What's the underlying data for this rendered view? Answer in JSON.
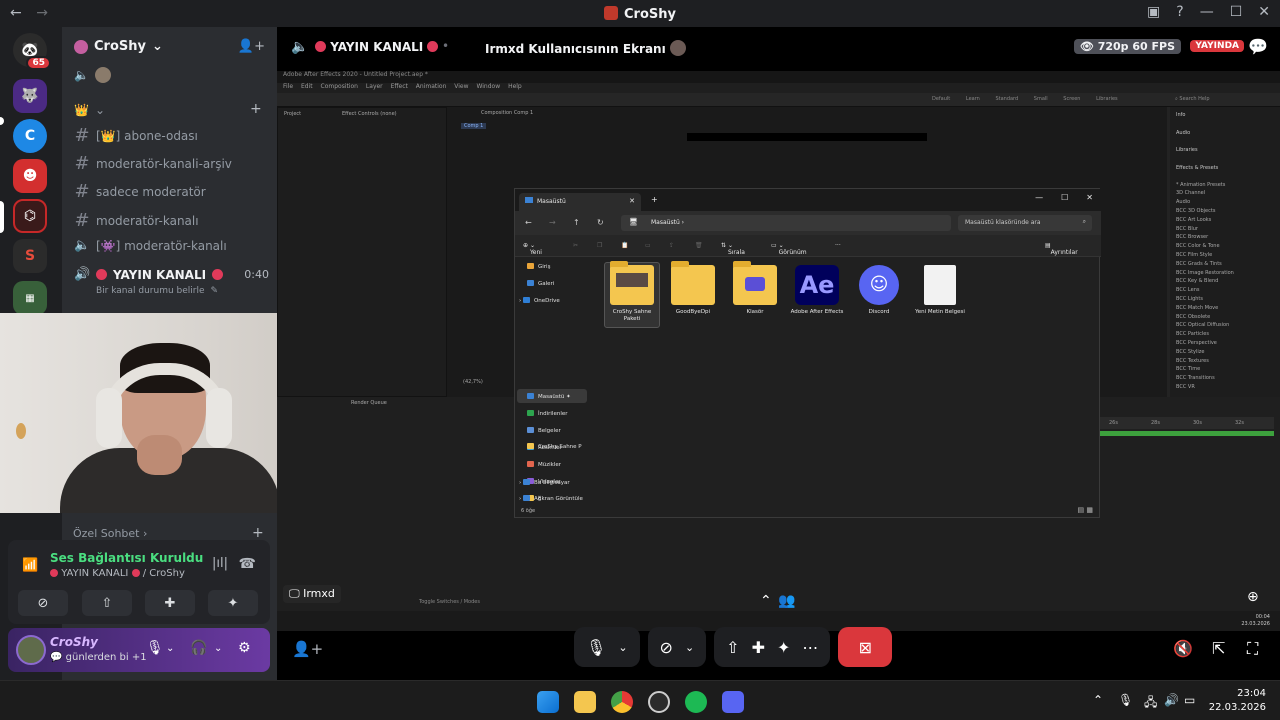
{
  "window": {
    "title": "CroShy",
    "back": "←",
    "forward": "→"
  },
  "server": {
    "name": "CroShy",
    "badge_count": "65"
  },
  "channels": [
    {
      "type": "text",
      "name": "[👑] abone-odası"
    },
    {
      "type": "text",
      "name": "moderatör-kanali-arşiv"
    },
    {
      "type": "text",
      "name": "sadece moderatör"
    },
    {
      "type": "text",
      "name": "moderatör-kanalı"
    },
    {
      "type": "voice",
      "name": "[👾] moderatör-kanalı"
    }
  ],
  "live_channel": {
    "name": "YAYIN KANALI",
    "time": "0:40",
    "status_placeholder": "Bir kanal durumu belirle"
  },
  "private_chat": {
    "label": "Özel Sohbet"
  },
  "voice_panel": {
    "status": "Ses Bağlantısı Kuruldu",
    "channel": "YAYIN KANALI",
    "server": "/ CroShy"
  },
  "user": {
    "name": "CroShy",
    "status": "günlerden bi +1"
  },
  "stream_header": {
    "channel": "YAYIN KANALI",
    "screen_title": "Irmxd Kullanıcısının Ekranı",
    "quality": "720p 60 FPS",
    "live_badge": "YAYINDA"
  },
  "viewer_label": "Irmxd",
  "after_effects": {
    "title": "Adobe After Effects 2020 - Untitled Project.aep *",
    "menu": [
      "File",
      "Edit",
      "Composition",
      "Layer",
      "Effect",
      "Animation",
      "View",
      "Window",
      "Help"
    ],
    "workspaces": [
      "Default",
      "Learn",
      "Standard",
      "Small Screen",
      "Libraries"
    ],
    "search_help": "Search Help",
    "panels": {
      "project": "Project",
      "effect_controls": "Effect Controls (none)",
      "composition": "Composition Comp 1",
      "comp_tab": "Comp 1",
      "render_queue": "Render Queue",
      "zoom": "(42,7%)",
      "toggle": "Toggle Switches / Modes"
    },
    "right_panel": {
      "headings": [
        "Info",
        "Audio",
        "Libraries",
        "Effects & Presets"
      ],
      "items": [
        "* Animation Presets",
        "3D Channel",
        "Audio",
        "BCC 3D Objects",
        "BCC Art Looks",
        "BCC Blur",
        "BCC Browser",
        "BCC Color & Tone",
        "BCC Film Style",
        "BCC Grads & Tints",
        "BCC Image Restoration",
        "BCC Key & Blend",
        "BCC Lens",
        "BCC Lights",
        "BCC Match Move",
        "BCC Obsolete",
        "BCC Optical Diffusion",
        "BCC Particles",
        "BCC Perspective",
        "BCC Stylize",
        "BCC Textures",
        "BCC Time",
        "BCC Transitions",
        "BCC VR"
      ]
    },
    "ruler": [
      "26s",
      "28s",
      "30s",
      "32s"
    ]
  },
  "explorer": {
    "tab_title": "Masaüstü",
    "path": "Masaüstü",
    "search_placeholder": "Masaüstü klasöründe ara",
    "toolbar": {
      "new": "Yeni",
      "sort": "Sırala",
      "view": "Görünüm",
      "more": "···",
      "details": "Ayrıntılar"
    },
    "nav": [
      {
        "label": "Giriş",
        "color": "#e9a53a"
      },
      {
        "label": "Galeri",
        "color": "#3b82d4"
      },
      {
        "label": "OneDrive",
        "color": "#2f7fd6"
      },
      {
        "label": "Masaüstü",
        "color": "#3b82d4"
      },
      {
        "label": "İndirilenler",
        "color": "#2da44e"
      },
      {
        "label": "Belgeler",
        "color": "#5b8fd6"
      },
      {
        "label": "Resimler",
        "color": "#3aa0d6"
      },
      {
        "label": "Müzikler",
        "color": "#e2654e"
      },
      {
        "label": "Videolar",
        "color": "#8a5cd6"
      },
      {
        "label": "Ekran Görüntüle",
        "color": "#f4c64f"
      },
      {
        "label": "CroShy Sahne P",
        "color": "#f4c64f"
      },
      {
        "label": "Bu bilgisayar",
        "color": "#3b82d4"
      },
      {
        "label": "Ağ",
        "color": "#3b82d4"
      }
    ],
    "files": [
      {
        "label": "CroShy Sahne Paketi",
        "kind": "folder-image"
      },
      {
        "label": "GoodByeDpi",
        "kind": "folder"
      },
      {
        "label": "Klasör",
        "kind": "folder-media"
      },
      {
        "label": "Adobe After Effects",
        "kind": "ae",
        "glyph": "Ae"
      },
      {
        "label": "Discord",
        "kind": "discord"
      },
      {
        "label": "Yeni Metin Belgesi",
        "kind": "text"
      }
    ],
    "status": "6 öğe"
  },
  "taskbar": {
    "time": "23:04",
    "date": "22.03.2026"
  },
  "inner_taskbar": {
    "time": "00:04",
    "date": "23.03.2026"
  },
  "colors": {
    "live_red": "#da373c",
    "green": "#4ade80",
    "blurple": "#5865f2"
  }
}
